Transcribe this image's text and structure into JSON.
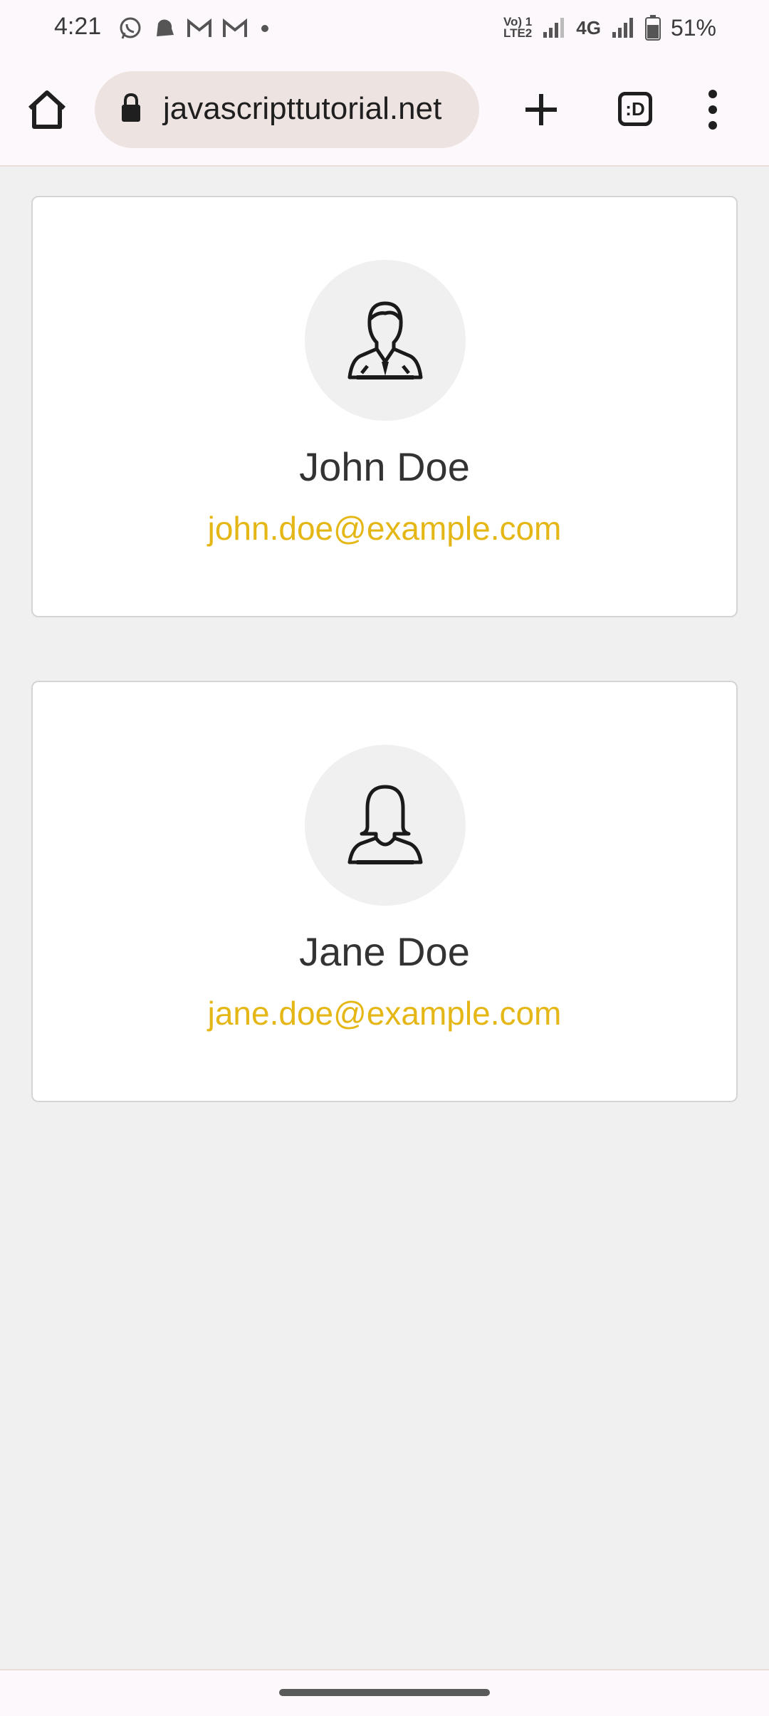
{
  "status_bar": {
    "time": "4:21",
    "volte_line1": "Vo) 1",
    "volte_line2": "LTE2",
    "network": "4G",
    "battery": "51%",
    "icons": [
      "whatsapp-icon",
      "notification-icon",
      "gmail-icon",
      "gmail-icon",
      "dot-icon",
      "signal-icon",
      "battery-icon"
    ]
  },
  "browser": {
    "url": "javascripttutorial.net",
    "tab_label": ":D",
    "icons": [
      "home-icon",
      "lock-icon",
      "plus-icon",
      "more-vert-icon"
    ]
  },
  "contacts": [
    {
      "name": "John Doe",
      "email": "john.doe@example.com",
      "avatar_icon": "male-user-icon"
    },
    {
      "name": "Jane Doe",
      "email": "jane.doe@example.com",
      "avatar_icon": "female-user-icon"
    }
  ],
  "colors": {
    "email": "#e5b716",
    "name": "#333333",
    "page_bg": "#f0f0f0",
    "card_bg": "#ffffff",
    "avatar_bg": "#f0f0f0"
  }
}
